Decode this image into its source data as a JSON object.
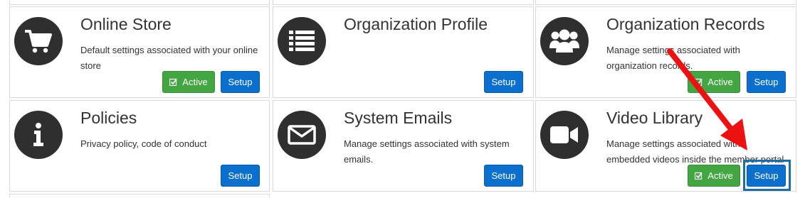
{
  "cards": [
    {
      "title": "Online Store",
      "description": "Default settings associated with your online store",
      "icon": "shopping-cart-icon",
      "active_label": "Active",
      "setup_label": "Setup"
    },
    {
      "title": "Organization Profile",
      "description": "",
      "icon": "list-icon",
      "setup_label": "Setup"
    },
    {
      "title": "Organization Records",
      "description": "Manage settings associated with organization records.",
      "icon": "users-icon",
      "active_label": "Active",
      "setup_label": "Setup"
    },
    {
      "title": "Policies",
      "description": "Privacy policy, code of conduct",
      "icon": "info-icon",
      "setup_label": "Setup"
    },
    {
      "title": "System Emails",
      "description": "Manage settings associated with system emails.",
      "icon": "envelope-icon",
      "setup_label": "Setup"
    },
    {
      "title": "Video Library",
      "description": "Manage settings associated with embedded videos inside the member portal",
      "icon": "video-camera-icon",
      "active_label": "Active",
      "setup_label": "Setup"
    }
  ],
  "colors": {
    "setup_button": "#0b6fce",
    "active_button": "#43a643",
    "icon_circle": "#2f2f2f",
    "annotation_arrow": "#ee1111",
    "annotation_box": "#1d6fa3"
  }
}
